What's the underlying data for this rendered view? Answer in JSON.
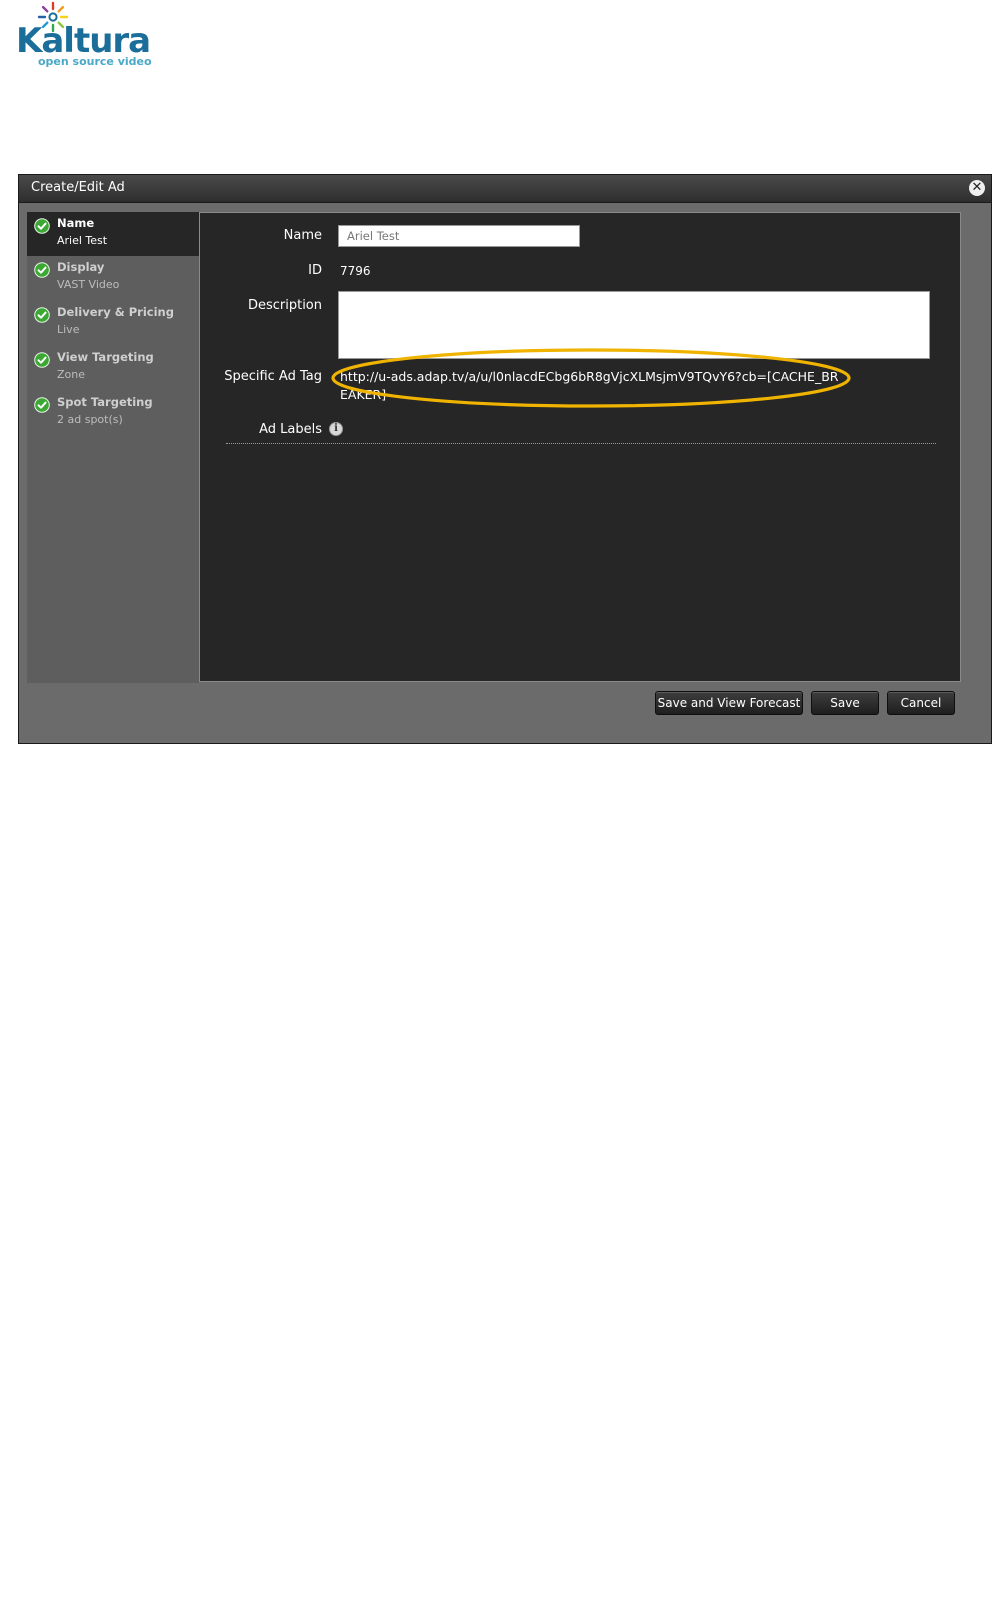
{
  "logo": {
    "name": "Kaltura",
    "tagline": "open source video"
  },
  "dialog": {
    "title": "Create/Edit Ad",
    "close_icon": "close-icon"
  },
  "steps": [
    {
      "label": "Name",
      "sub": "Ariel Test",
      "active": true,
      "icon": "check-circle-icon"
    },
    {
      "label": "Display",
      "sub": "VAST Video",
      "active": false,
      "icon": "check-circle-icon"
    },
    {
      "label": "Delivery & Pricing",
      "sub": "Live",
      "active": false,
      "icon": "check-circle-icon"
    },
    {
      "label": "View Targeting",
      "sub": "Zone",
      "active": false,
      "icon": "check-circle-icon"
    },
    {
      "label": "Spot Targeting",
      "sub": "2 ad spot(s)",
      "active": false,
      "icon": "check-circle-icon"
    }
  ],
  "form": {
    "name_label": "Name",
    "name_value": "Ariel Test",
    "id_label": "ID",
    "id_value": "7796",
    "description_label": "Description",
    "description_value": "",
    "ad_tag_label": "Specific Ad Tag",
    "ad_tag_value": "http://u-ads.adap.tv/a/u/l0nlacdECbg6bR8gVjcXLMsjmV9TQvY6?cb=[CACHE_BREAKER]",
    "ad_labels_label": "Ad Labels",
    "info_icon": "info-icon"
  },
  "buttons": {
    "save_forecast": "Save and View Forecast",
    "save": "Save",
    "cancel": "Cancel"
  },
  "colors": {
    "highlight": "#f0b400",
    "check_green": "#3aa832",
    "brand_blue": "#1c6e9a"
  }
}
